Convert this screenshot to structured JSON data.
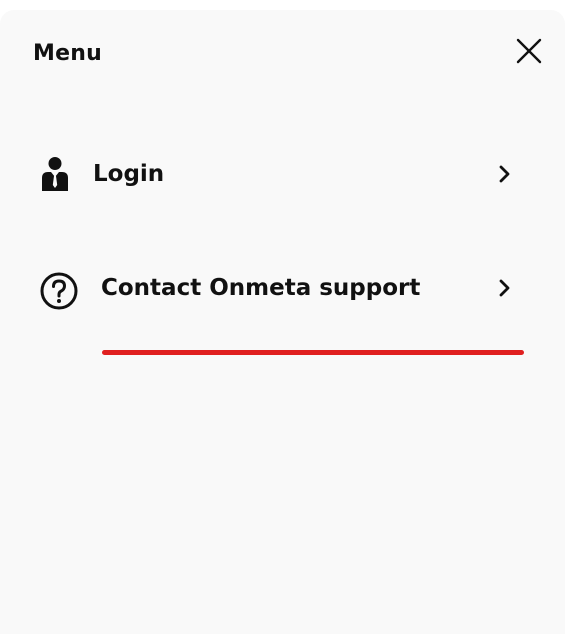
{
  "menu": {
    "title": "Menu",
    "close_icon": "close-icon",
    "items": [
      {
        "label": "Login",
        "icon": "user-icon",
        "chevron_icon": "chevron-right-icon"
      },
      {
        "label": "Contact Onmeta support",
        "icon": "help-circle-icon",
        "chevron_icon": "chevron-right-icon"
      }
    ]
  },
  "colors": {
    "panel_background": "#f9f9f9",
    "text": "#111111",
    "highlight_underline": "#e02020"
  }
}
